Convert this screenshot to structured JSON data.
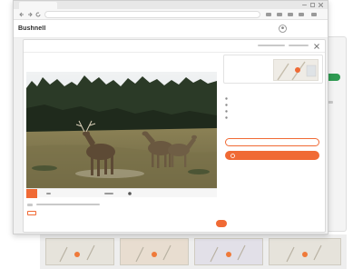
{
  "browser": {
    "tab_title": "",
    "address": ""
  },
  "app": {
    "brand": "Bushnell",
    "account_label": ""
  },
  "modal": {
    "title": "",
    "camera_section_label": "",
    "camera_name": "",
    "details_label": "",
    "details_lines": [
      "",
      "",
      "",
      ""
    ],
    "outline_button_label": "",
    "primary_button_label": "",
    "footer_note": "",
    "cancel_label": "",
    "confirm_label": "",
    "photo_caption": {
      "badge": "",
      "timestamp": ""
    }
  },
  "colors": {
    "accent": "#f06a35",
    "sky": "#e4e8eb",
    "field": "#786e4a",
    "treeline": "#243121"
  },
  "icons": {
    "close": "close-icon",
    "back": "arrow-left-icon",
    "forward": "arrow-right-icon",
    "reload": "reload-icon",
    "deer": "deer-photo"
  }
}
